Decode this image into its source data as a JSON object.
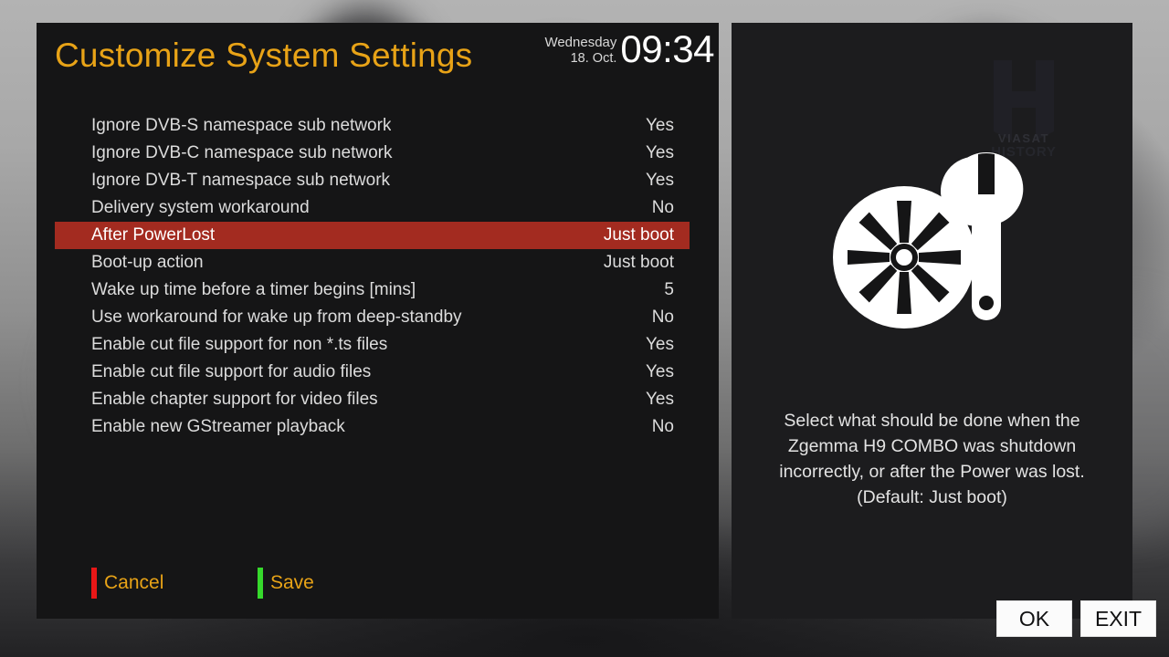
{
  "header": {
    "title": "Customize System Settings",
    "clock": {
      "weekday": "Wednesday",
      "daymonth": "18. Oct.",
      "time": "09:34"
    }
  },
  "settings": {
    "rows": [
      {
        "label": "Ignore DVB-S namespace sub network",
        "value": "Yes",
        "selected": false
      },
      {
        "label": "Ignore DVB-C namespace sub network",
        "value": "Yes",
        "selected": false
      },
      {
        "label": "Ignore DVB-T namespace sub network",
        "value": "Yes",
        "selected": false
      },
      {
        "label": "Delivery system workaround",
        "value": "No",
        "selected": false
      },
      {
        "label": "After PowerLost",
        "value": "Just boot",
        "selected": true
      },
      {
        "label": "Boot-up action",
        "value": "Just boot",
        "selected": false
      },
      {
        "label": "Wake up time before a timer begins [mins]",
        "value": "5",
        "selected": false
      },
      {
        "label": "Use workaround for wake up from deep-standby",
        "value": "No",
        "selected": false
      },
      {
        "label": "Enable cut file support for non *.ts files",
        "value": "Yes",
        "selected": false
      },
      {
        "label": "Enable cut file support for audio files",
        "value": "Yes",
        "selected": false
      },
      {
        "label": "Enable chapter support for video files",
        "value": "Yes",
        "selected": false
      },
      {
        "label": "Enable new GStreamer playback",
        "value": "No",
        "selected": false
      }
    ]
  },
  "key_buttons": {
    "cancel": {
      "label": "Cancel",
      "color": "#e81717"
    },
    "save": {
      "label": "Save",
      "color": "#36d92c"
    }
  },
  "help": {
    "text": "Select what should be done when the Zgemma H9 COMBO was shutdown incorrectly, or after the Power was lost. (Default: Just boot)"
  },
  "right_buttons": {
    "ok": "OK",
    "exit": "EXIT"
  },
  "icons": {
    "tool": "gear-and-wrench-icon",
    "channel_logo_line1": "VIASAT",
    "channel_logo_line2": "HISTORY"
  },
  "colors": {
    "title": "#E8A317",
    "selection": "#A32B20",
    "key_label": "#E8A317",
    "panel": "#151516"
  }
}
